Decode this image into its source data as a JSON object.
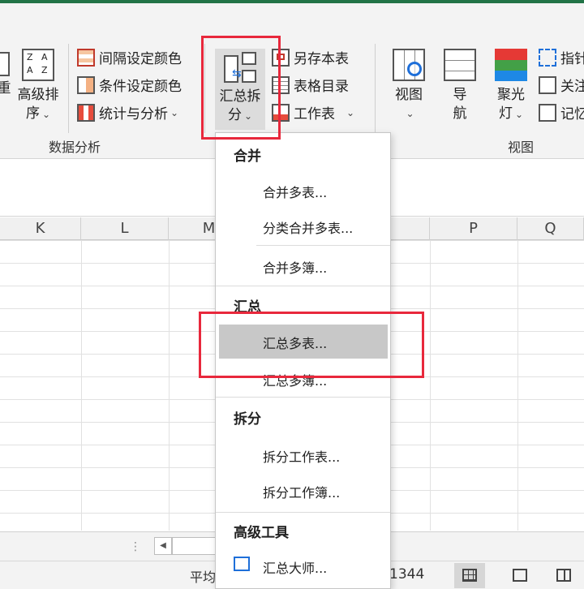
{
  "ribbon": {
    "sort_group": {
      "partial_left": "重",
      "advanced_sort_line1": "高级排",
      "advanced_sort_line2": "序"
    },
    "data_analysis": {
      "interval_color": "间隔设定颜色",
      "condition_color": "条件设定颜色",
      "stats_analysis": "统计与分析",
      "group_label": "数据分析"
    },
    "summary_split": {
      "line1": "汇总拆",
      "line2": "分"
    },
    "sheet_tools": {
      "save_as_sheet": "另存本表",
      "sheet_index": "表格目录",
      "worksheet": "工作表"
    },
    "view_group": {
      "view": "视图",
      "nav_line1": "导",
      "nav_line2": "航",
      "spotlight_line1": "聚光",
      "spotlight_line2": "灯",
      "group_label": "视图",
      "right_item1": "指针",
      "right_item2": "关注",
      "right_item3": "记忆"
    },
    "colors": {
      "spotlight_red": "#e53935",
      "spotlight_green": "#43a047",
      "spotlight_blue": "#1e88e5",
      "accent_red": "#e8283c"
    }
  },
  "columns": [
    "K",
    "L",
    "M",
    "",
    "P",
    "Q"
  ],
  "dropdown": {
    "sections": {
      "merge": "合并",
      "summary": "汇总",
      "split": "拆分",
      "advanced": "高级工具"
    },
    "items": {
      "merge_sheets": "合并多表...",
      "category_merge": "分类合并多表...",
      "merge_workbooks": "合并多簿...",
      "summary_sheets": "汇总多表...",
      "summary_workbooks": "汇总多簿...",
      "split_sheet": "拆分工作表...",
      "split_workbook": "拆分工作簿...",
      "summary_master": "汇总大师..."
    }
  },
  "status": {
    "avg_label": "平均",
    "count_value": "1344"
  }
}
